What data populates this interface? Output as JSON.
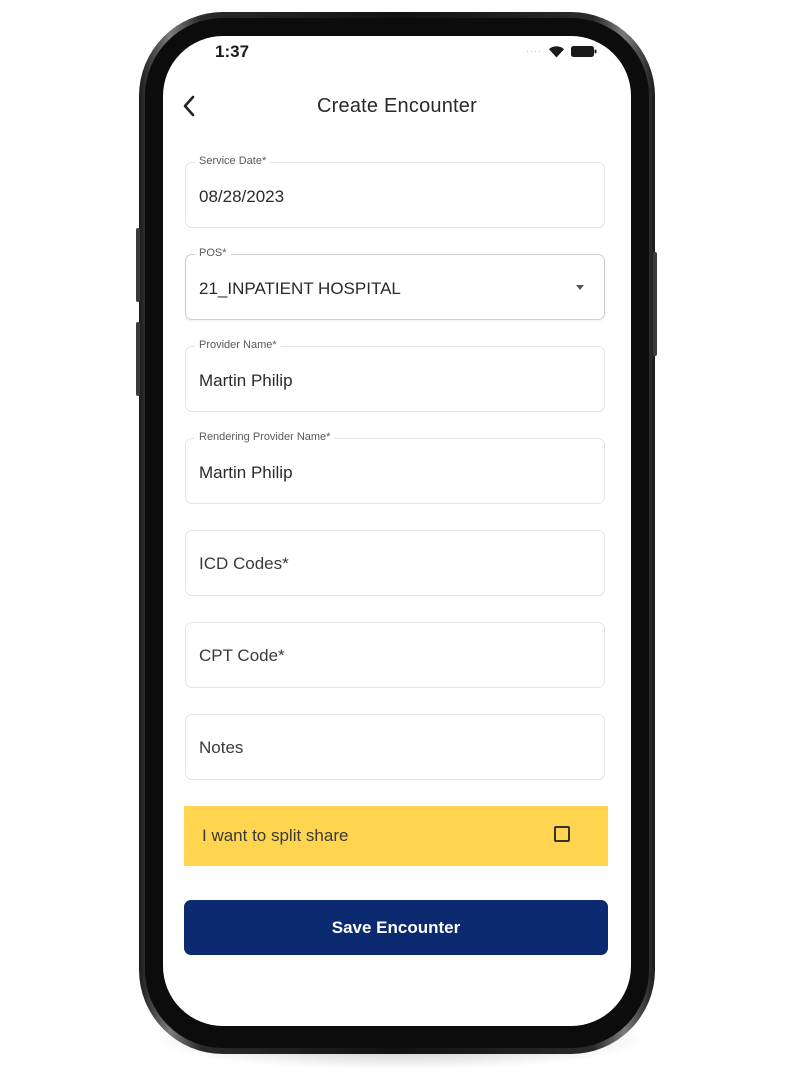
{
  "status_bar": {
    "time": "1:37",
    "icons": [
      "signal-dots-icon",
      "wifi-icon",
      "battery-icon"
    ]
  },
  "header": {
    "title": "Create Encounter",
    "back_icon": "back-chevron-icon"
  },
  "form": {
    "service_date": {
      "label": "Service Date*",
      "value": "08/28/2023"
    },
    "pos": {
      "label": "POS*",
      "value": "21_INPATIENT HOSPITAL",
      "icon": "dropdown-arrow-icon"
    },
    "provider_name": {
      "label": "Provider Name*",
      "value": "Martin Philip"
    },
    "rendering_provider_name": {
      "label": "Rendering Provider Name*",
      "value": "Martin Philip"
    },
    "icd_codes": {
      "placeholder": "ICD Codes*"
    },
    "cpt_code": {
      "placeholder": "CPT Code*"
    },
    "notes": {
      "placeholder": "Notes"
    }
  },
  "split_share": {
    "label": "I want to split share",
    "checked": false
  },
  "save_button": {
    "label": "Save Encounter"
  },
  "colors": {
    "accent_yellow": "#ffd54f",
    "primary_navy": "#0b2a6f"
  }
}
